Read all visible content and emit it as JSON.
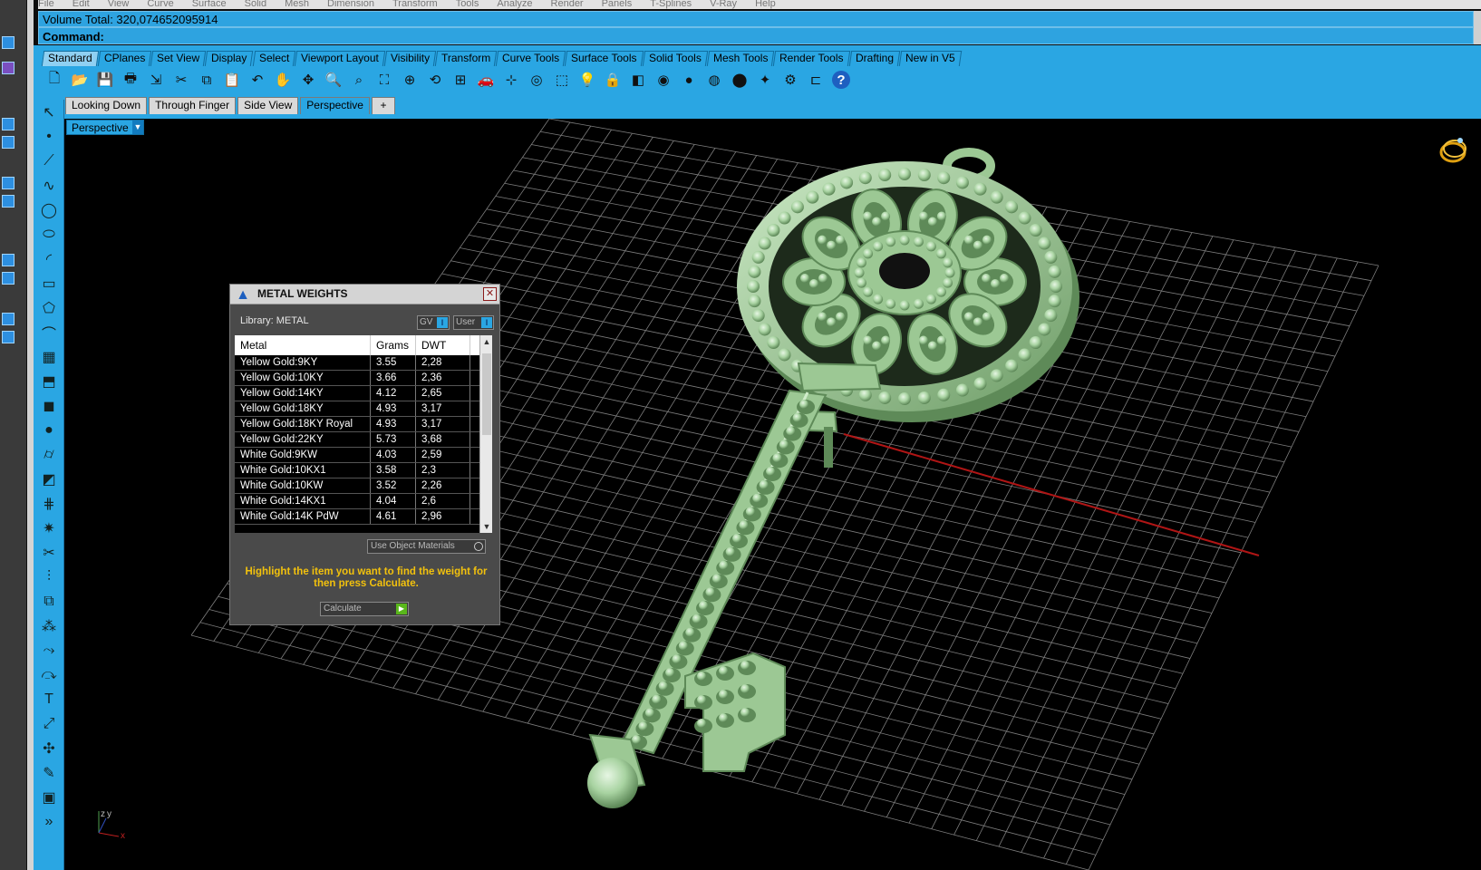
{
  "menu": [
    "File",
    "Edit",
    "View",
    "Curve",
    "Surface",
    "Solid",
    "Mesh",
    "Dimension",
    "Transform",
    "Tools",
    "Analyze",
    "Render",
    "Panels",
    "T-Splines",
    "V-Ray",
    "Help"
  ],
  "history": {
    "text": "Volume Total: 320,074652095914"
  },
  "command": {
    "label": "Command:"
  },
  "toolbar_tabs": [
    {
      "label": "Standard",
      "active": true
    },
    {
      "label": "CPlanes"
    },
    {
      "label": "Set View"
    },
    {
      "label": "Display"
    },
    {
      "label": "Select"
    },
    {
      "label": "Viewport Layout"
    },
    {
      "label": "Visibility"
    },
    {
      "label": "Transform"
    },
    {
      "label": "Curve Tools"
    },
    {
      "label": "Surface Tools"
    },
    {
      "label": "Solid Tools"
    },
    {
      "label": "Mesh Tools"
    },
    {
      "label": "Render Tools"
    },
    {
      "label": "Drafting"
    },
    {
      "label": "New in V5"
    }
  ],
  "toolbar_icons": [
    "new-icon",
    "open-icon",
    "save-icon",
    "print-icon",
    "import-icon",
    "cut-icon",
    "copy-icon",
    "paste-icon",
    "undo-icon",
    "pan-icon",
    "rotate-view-icon",
    "zoom-icon",
    "zoom-window-icon",
    "zoom-extents-icon",
    "zoom-selected-icon",
    "undo-view-icon",
    "four-viewports-icon",
    "car-icon",
    "grid-snap-icon",
    "osnap-icon",
    "object-properties-icon",
    "light-icon",
    "lock-icon",
    "layer-icon",
    "color-wheel-icon",
    "shaded-sphere-icon",
    "rendered-sphere-icon",
    "render-icon",
    "light-bulb-icon",
    "options-gear-icon",
    "dimension-icon",
    "help-icon"
  ],
  "viewport_tabs": [
    {
      "label": "Looking Down"
    },
    {
      "label": "Through Finger"
    },
    {
      "label": "Side View"
    },
    {
      "label": "Perspective",
      "active": true
    },
    {
      "label": "+"
    }
  ],
  "viewport": {
    "label": "Perspective",
    "axis_z": "z",
    "axis_y": "y",
    "axis_x": "x"
  },
  "left_tools": [
    "select-arrow-icon",
    "point-icon",
    "polyline-icon",
    "curve-cv-icon",
    "circle-icon",
    "ellipse-icon",
    "arc-icon",
    "rectangle-icon",
    "polygon-icon",
    "fillet-curve-icon",
    "surface-cv-icon",
    "extrude-icon",
    "box-icon",
    "sphere-icon",
    "cylinder-icon",
    "surface-from-edges-icon",
    "mesh-icon",
    "explode-icon",
    "trim-icon",
    "split-icon",
    "boolean-union-icon",
    "array-icon",
    "blend-icon",
    "offset-icon",
    "text-icon",
    "transform-icon",
    "array-polar-icon",
    "edit-icon",
    "render-box-icon",
    "more-icon"
  ],
  "metal_weights": {
    "title": "METAL WEIGHTS",
    "library_label": "Library: METAL",
    "gv_label": "GV",
    "user_label": "User",
    "columns": [
      "Metal",
      "Grams",
      "DWT"
    ],
    "rows": [
      [
        "Yellow Gold:9KY",
        "3.55",
        "2,28"
      ],
      [
        "Yellow Gold:10KY",
        "3.66",
        "2,36"
      ],
      [
        "Yellow Gold:14KY",
        "4.12",
        "2,65"
      ],
      [
        "Yellow Gold:18KY",
        "4.93",
        "3,17"
      ],
      [
        "Yellow Gold:18KY Royal",
        "4.93",
        "3,17"
      ],
      [
        "Yellow Gold:22KY",
        "5.73",
        "3,68"
      ],
      [
        "White Gold:9KW",
        "4.03",
        "2,59"
      ],
      [
        "White Gold:10KX1",
        "3.58",
        "2,3"
      ],
      [
        "White Gold:10KW",
        "3.52",
        "2,26"
      ],
      [
        "White Gold:14KX1",
        "4.04",
        "2,6"
      ],
      [
        "White Gold:14K PdW",
        "4.61",
        "2,96"
      ]
    ],
    "use_object_materials": "Use Object Materials",
    "message": "Highlight the item you want to find the weight for then press Calculate.",
    "calculate_label": "Calculate"
  },
  "colors": {
    "accent": "#2aa6e3",
    "model": "#a9d6a3",
    "grid": "#8a8a8a",
    "x_axis": "#b01515",
    "message": "#f2c10d"
  }
}
